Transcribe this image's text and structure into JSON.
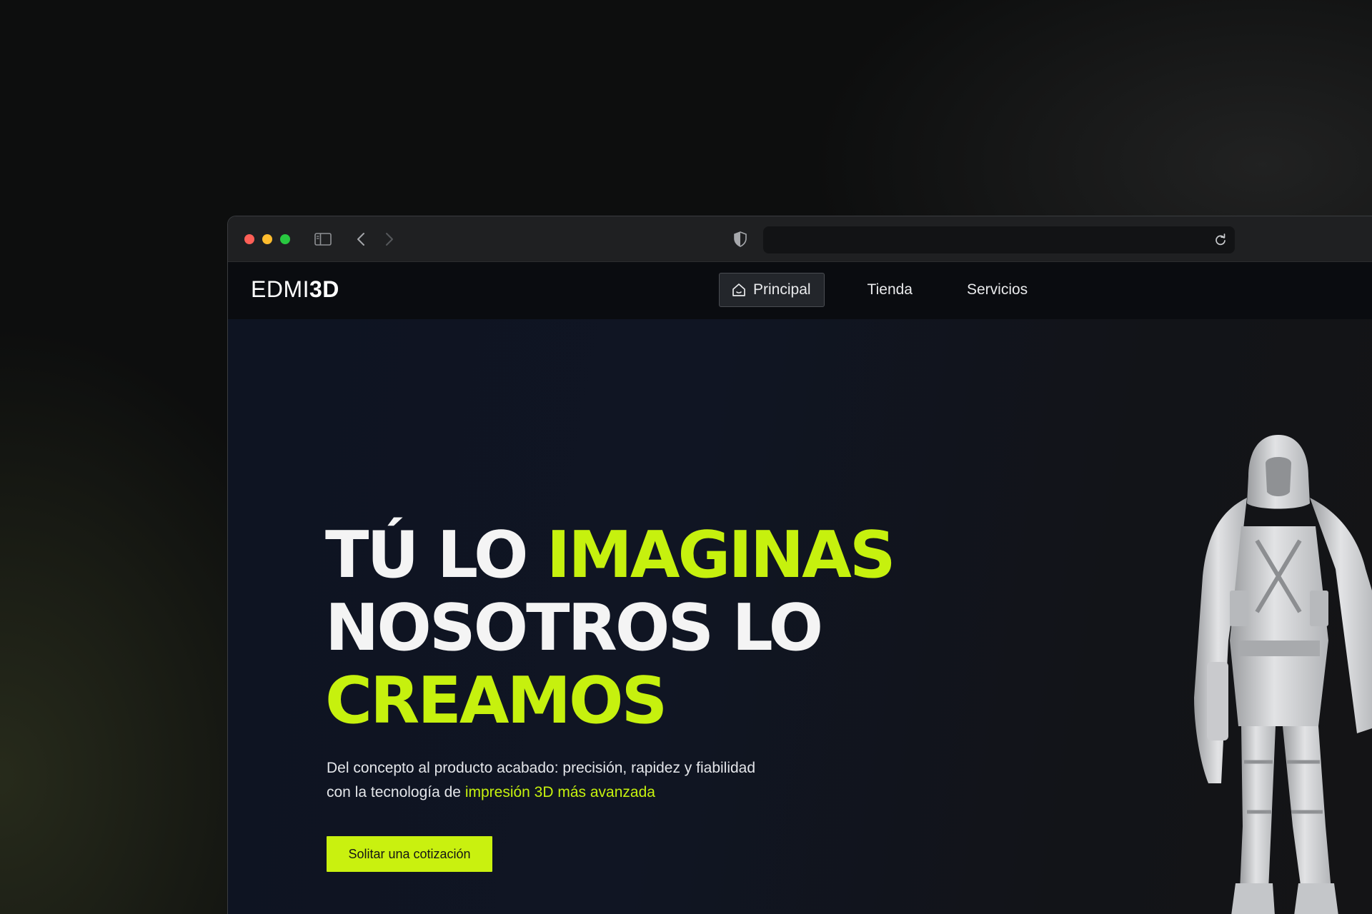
{
  "browser": {
    "traffic_lights": {
      "close": "#fe5f57",
      "minimize": "#febc2e",
      "maximize": "#28c840"
    },
    "url": ""
  },
  "site": {
    "logo": {
      "light": "EDMI",
      "bold": "3D"
    },
    "nav": {
      "items": [
        {
          "label": "Principal",
          "icon": "home-icon",
          "active": true
        },
        {
          "label": "Tienda",
          "active": false
        },
        {
          "label": "Servicios",
          "active": false
        }
      ]
    },
    "hero": {
      "headline": {
        "line1_white": "TÚ LO ",
        "line1_accent": "IMAGINAS",
        "line2_white": "NOSOTROS LO",
        "line3_accent": "CREAMOS"
      },
      "subtext_white": "Del concepto al producto acabado: precisión, rapidez y fiabilidad con la tecnología de ",
      "subtext_accent": "impresión 3D más avanzada",
      "cta_label": "Solitar una cotización",
      "figure_icon": "hooded-figure-model"
    },
    "colors": {
      "accent": "#c6f10e",
      "background": "#0f1419"
    }
  }
}
